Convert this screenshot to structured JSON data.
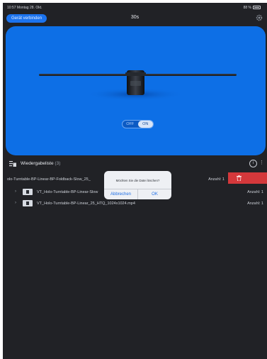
{
  "status_bar": {
    "time": "10:57",
    "date": "Montag 28. Okt.",
    "battery": "88 %"
  },
  "header": {
    "connect_label": "Gerät verbinden",
    "timer": "30s",
    "settings_icon": "gear-icon"
  },
  "preview": {
    "background": "#0d6fe6",
    "toggle": {
      "off_label": "OFF",
      "on_label": "ON",
      "state": "ON"
    }
  },
  "playlist": {
    "title": "Wiedergabeliste",
    "count": "(3)",
    "icons": [
      "playlist-icon",
      "info-icon",
      "more-icon"
    ],
    "rows": [
      {
        "name": "olo-Turntable-BP-Linear-BP-Foldback-Slow_25_",
        "qty": "Anzahl: 1"
      },
      {
        "name": "VT_Holo-Turntable-BP-Linear-Slow",
        "qty": "Anzahl: 1"
      },
      {
        "name": "VT_Holo-Turntable-BP-Linear_25_HTQ_1024x1024.mp4",
        "qty": "Anzahl: 1"
      }
    ]
  },
  "delete_action": {
    "icon": "trash-icon",
    "color": "#d4383b"
  },
  "dialog": {
    "message": "Möchten Sie die Datei löschen?",
    "cancel_label": "Abbrechen",
    "ok_label": "OK"
  }
}
